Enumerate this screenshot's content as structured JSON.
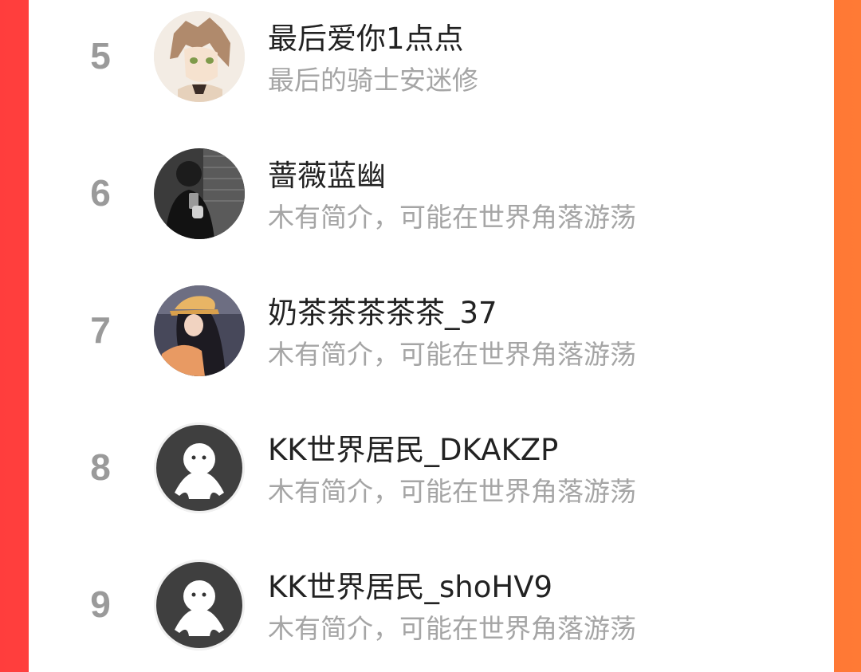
{
  "ranking": {
    "items": [
      {
        "rank": "5",
        "name": "最后爱你1点点",
        "bio": "最后的骑士安迷修",
        "avatar_icon": "anime-character-avatar-icon"
      },
      {
        "rank": "6",
        "name": "蔷薇蓝幽",
        "bio": "木有简介，可能在世界角落游荡",
        "avatar_icon": "person-selfie-avatar-icon"
      },
      {
        "rank": "7",
        "name": "奶茶茶茶茶茶_37",
        "bio": "木有简介，可能在世界角落游荡",
        "avatar_icon": "person-cap-avatar-icon"
      },
      {
        "rank": "8",
        "name": "KK世界居民_DKAKZP",
        "bio": "木有简介，可能在世界角落游荡",
        "avatar_icon": "default-avatar-icon"
      },
      {
        "rank": "9",
        "name": "KK世界居民_shoHV9",
        "bio": "木有简介，可能在世界角落游荡",
        "avatar_icon": "default-avatar-icon"
      }
    ]
  },
  "colors": {
    "background_left": "#ff3d3d",
    "background_right": "#ff7a35",
    "panel": "#ffffff",
    "rank_text": "#9a9a9a",
    "name_text": "#222222",
    "bio_text": "#a5a5a5"
  }
}
